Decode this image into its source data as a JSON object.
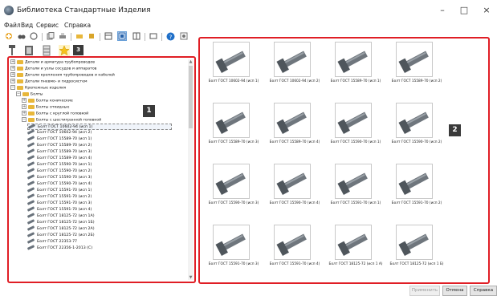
{
  "window": {
    "title": "Библиотека Стандартные Изделия",
    "minimize_glyph": "–",
    "maximize_glyph": "□",
    "close_glyph": "×"
  },
  "menu": [
    "Файл",
    "Вид",
    "Сервис",
    "Справка"
  ],
  "toolbar_icons": [
    "add-icon",
    "binoculars-icon",
    "filter-icon",
    "copy-icon",
    "print-icon",
    "folder-icon",
    "text-icon",
    "view-list-icon",
    "view-thumbnail-icon",
    "table-icon",
    "help-icon",
    "settings-icon"
  ],
  "iconbar_icons": [
    "bolt-type-icon",
    "book-icon",
    "table-config-icon",
    "favorites-star-icon"
  ],
  "badges": {
    "tree": "1",
    "grid": "2",
    "favorites": "3"
  },
  "tree": [
    {
      "label": "Детали и арматура трубопроводов",
      "level": 0,
      "type": "folder",
      "expander": "+"
    },
    {
      "label": "Детали и узлы сосудов и аппаратов",
      "level": 0,
      "type": "folder",
      "expander": "+"
    },
    {
      "label": "Детали крепления трубопроводов и кабелей",
      "level": 0,
      "type": "folder",
      "expander": "+"
    },
    {
      "label": "Детали пневмо- и гидросистем",
      "level": 0,
      "type": "folder",
      "expander": "+"
    },
    {
      "label": "Крепежные изделия",
      "level": 0,
      "type": "folder",
      "expander": "−"
    },
    {
      "label": "Болты",
      "level": 1,
      "type": "folder",
      "expander": "−"
    },
    {
      "label": "Болты конические",
      "level": 2,
      "type": "folder",
      "expander": "+"
    },
    {
      "label": "Болты откидные",
      "level": 2,
      "type": "folder",
      "expander": "+"
    },
    {
      "label": "Болты с круглой головкой",
      "level": 2,
      "type": "folder",
      "expander": "+"
    },
    {
      "label": "Болты с шестигранной головкой",
      "level": 2,
      "type": "folder",
      "expander": "−"
    },
    {
      "label": "Болт ГОСТ 10602-94 (исп 1)",
      "level": 3,
      "type": "bolt",
      "selected": true
    },
    {
      "label": "Болт ГОСТ 10602-94 (исп 2)",
      "level": 3,
      "type": "bolt"
    },
    {
      "label": "Болт ГОСТ 15589-70 (исп 1)",
      "level": 3,
      "type": "bolt"
    },
    {
      "label": "Болт ГОСТ 15589-70 (исп 2)",
      "level": 3,
      "type": "bolt"
    },
    {
      "label": "Болт ГОСТ 15589-70 (исп 3)",
      "level": 3,
      "type": "bolt"
    },
    {
      "label": "Болт ГОСТ 15589-70 (исп 4)",
      "level": 3,
      "type": "bolt"
    },
    {
      "label": "Болт ГОСТ 15590-70 (исп 1)",
      "level": 3,
      "type": "bolt"
    },
    {
      "label": "Болт ГОСТ 15590-70 (исп 2)",
      "level": 3,
      "type": "bolt"
    },
    {
      "label": "Болт ГОСТ 15590-70 (исп 3)",
      "level": 3,
      "type": "bolt"
    },
    {
      "label": "Болт ГОСТ 15590-70 (исп 4)",
      "level": 3,
      "type": "bolt"
    },
    {
      "label": "Болт ГОСТ 15591-70 (исп 1)",
      "level": 3,
      "type": "bolt"
    },
    {
      "label": "Болт ГОСТ 15591-70 (исп 2)",
      "level": 3,
      "type": "bolt"
    },
    {
      "label": "Болт ГОСТ 15591-70 (исп 3)",
      "level": 3,
      "type": "bolt"
    },
    {
      "label": "Болт ГОСТ 15591-70 (исп 4)",
      "level": 3,
      "type": "bolt"
    },
    {
      "label": "Болт ГОСТ 18125-72 (исп 1А)",
      "level": 3,
      "type": "bolt"
    },
    {
      "label": "Болт ГОСТ 18125-72 (исп 1Б)",
      "level": 3,
      "type": "bolt"
    },
    {
      "label": "Болт ГОСТ 18125-72 (исп 2А)",
      "level": 3,
      "type": "bolt"
    },
    {
      "label": "Болт ГОСТ 18125-72 (исп 2Б)",
      "level": 3,
      "type": "bolt"
    },
    {
      "label": "Болт ГОСТ 22353-77",
      "level": 3,
      "type": "bolt"
    },
    {
      "label": "Болт ГОСТ 22356-1-2013 (С)",
      "level": 3,
      "type": "bolt"
    }
  ],
  "grid_items": [
    "Болт ГОСТ 10602-94 (исп 1)",
    "Болт ГОСТ 10602-94 (исп 2)",
    "Болт ГОСТ 15589-70 (исп 1)",
    "Болт ГОСТ 15589-70 (исп 2)",
    "Болт ГОСТ 15589-70 (исп 3)",
    "Болт ГОСТ 15589-70 (исп 4)",
    "Болт ГОСТ 15590-70 (исп 1)",
    "Болт ГОСТ 15590-70 (исп 2)",
    "Болт ГОСТ 15590-70 (исп 3)",
    "Болт ГОСТ 15590-70 (исп 4)",
    "Болт ГОСТ 15591-70 (исп 1)",
    "Болт ГОСТ 15591-70 (исп 2)",
    "Болт ГОСТ 15591-70 (исп 3)",
    "Болт ГОСТ 15591-70 (исп 4)",
    "Болт ГОСТ 18125-72 (исп 1 А)",
    "Болт ГОСТ 18125-72 (исп 1 Б)"
  ],
  "buttons": {
    "apply": "Применить",
    "cancel": "Отмена",
    "help": "Справка"
  }
}
